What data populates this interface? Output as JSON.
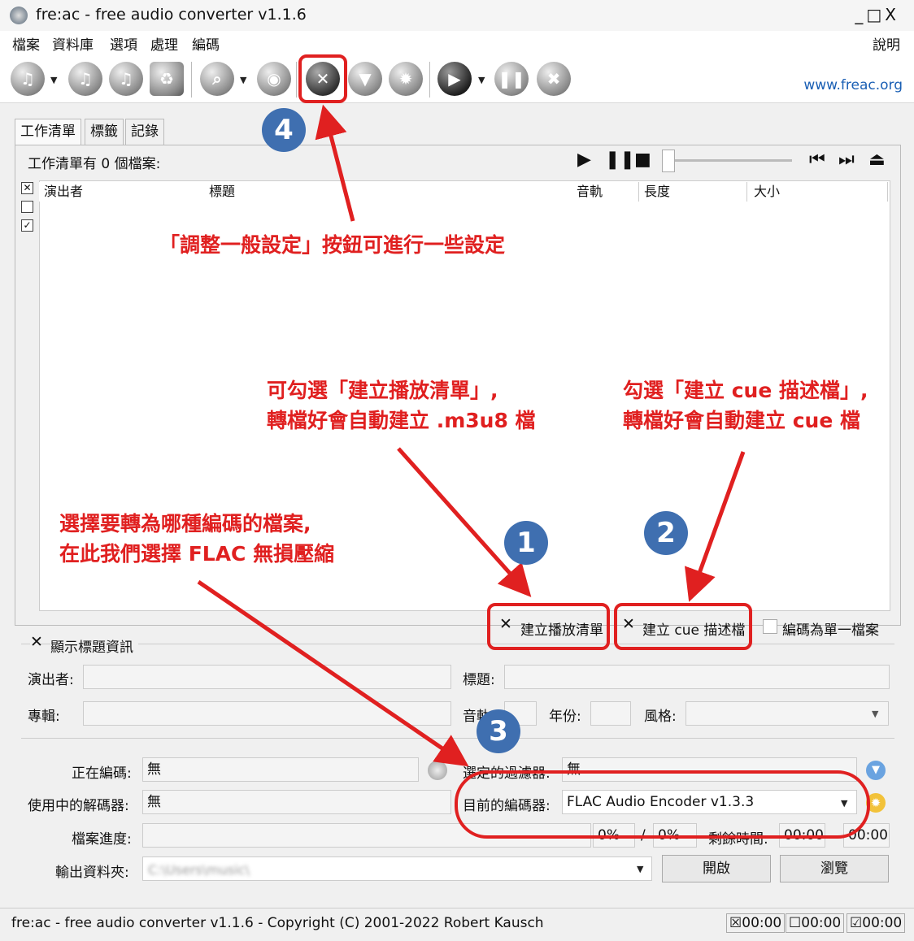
{
  "window": {
    "title": "fre:ac - free audio converter v1.1.6",
    "controls": "_□X"
  },
  "menu": {
    "items": [
      "檔案",
      "資料庫",
      "選項",
      "處理",
      "編碼"
    ],
    "help": "說明"
  },
  "toolbar": {
    "website": "www.freac.org"
  },
  "tabs": [
    "工作清單",
    "標籤",
    "記錄"
  ],
  "joblist": {
    "count_text": "工作清單有 0 個檔案:",
    "columns": [
      "演出者",
      "標題",
      "音軌",
      "長度",
      "大小"
    ],
    "options": {
      "playlist": "建立播放清單",
      "cue": "建立 cue 描述檔",
      "single": "編碼為單一檔案"
    }
  },
  "info": {
    "show_tags": "顯示標題資訊",
    "artist_label": "演出者:",
    "title_label": "標題:",
    "album_label": "專輯:",
    "track_label": "音軌:",
    "year_label": "年份:",
    "genre_label": "風格:"
  },
  "encode": {
    "encoding_label": "正在編碼:",
    "encoding_value": "無",
    "filter_label": "選定的過濾器:",
    "filter_value": "無",
    "decoder_label": "使用中的解碼器:",
    "decoder_value": "無",
    "encoder_label": "目前的編碼器:",
    "encoder_value": "FLAC Audio Encoder v1.3.3",
    "progress_label": "檔案進度:",
    "progress_pct1": "0%",
    "progress_sep": "/",
    "progress_pct2": "0%",
    "remaining_label": "剩餘時間:",
    "remaining_value": "00:00",
    "total_value": "00:00",
    "output_label": "輸出資料夾:",
    "output_value": "C:\\Users\\music\\",
    "open_button": "開啟",
    "browse_button": "瀏覽"
  },
  "status": {
    "text": "fre:ac - free audio converter v1.1.6 - Copyright (C) 2001-2022 Robert Kausch",
    "t1": "00:00",
    "t2": "00:00",
    "t3": "00:00"
  },
  "annotations": {
    "a4": "「調整一般設定」按鈕可進行一些設定",
    "a1_line1": "可勾選「建立播放清單」,",
    "a1_line2": "轉檔好會自動建立 .m3u8 檔",
    "a2_line1": "勾選「建立 cue 描述檔」,",
    "a2_line2": "轉檔好會自動建立 cue 檔",
    "a3_line1": "選擇要轉為哪種編碼的檔案,",
    "a3_line2": "在此我們選擇 FLAC 無損壓縮",
    "b1": "1",
    "b2": "2",
    "b3": "3",
    "b4": "4"
  }
}
